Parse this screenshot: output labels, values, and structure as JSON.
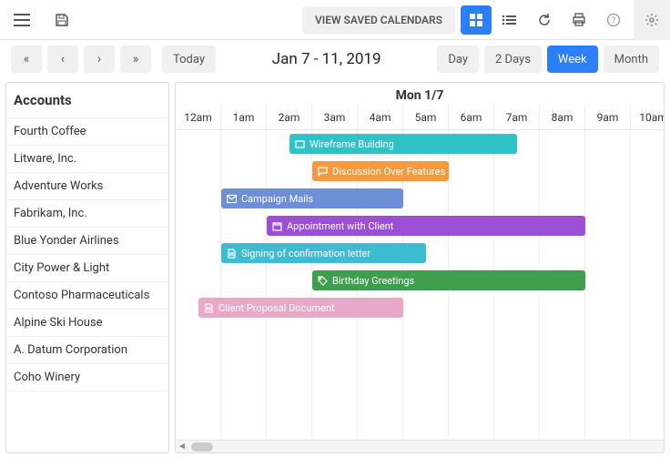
{
  "toolbar": {
    "viewSaved": "VIEW SAVED CALENDARS"
  },
  "nav": {
    "today": "Today",
    "rangeTitle": "Jan 7 - 11, 2019",
    "ranges": [
      "Day",
      "2 Days",
      "Week",
      "Month"
    ],
    "activeRange": 2
  },
  "sidebar": {
    "title": "Accounts",
    "items": [
      "Fourth Coffee",
      "Litware, Inc.",
      "Adventure Works",
      "Fabrikam, Inc.",
      "Blue Yonder Airlines",
      "City Power & Light",
      "Contoso Pharmaceuticals",
      "Alpine Ski House",
      "A. Datum Corporation",
      "Coho Winery"
    ]
  },
  "calendar": {
    "dayLabel": "Mon 1/7",
    "hours": [
      "12am",
      "1am",
      "2am",
      "3am",
      "4am",
      "5am",
      "6am",
      "7am",
      "8am",
      "9am",
      "10am"
    ],
    "hourWidth": 50,
    "events": [
      {
        "row": 0,
        "label": "Wireframe Building",
        "start": 2.5,
        "end": 7.5,
        "color": "#2FC2C7",
        "icon": "card"
      },
      {
        "row": 1,
        "label": "Discussion Over Features",
        "start": 3.0,
        "end": 6.0,
        "color": "#F29B3E",
        "icon": "chat"
      },
      {
        "row": 2,
        "label": "Campaign Mails",
        "start": 1.0,
        "end": 5.0,
        "color": "#6C8FD6",
        "icon": "mail"
      },
      {
        "row": 3,
        "label": "Appointment with Client",
        "start": 2.0,
        "end": 9.0,
        "color": "#9B4FD6",
        "icon": "cal"
      },
      {
        "row": 4,
        "label": "Signing of confirmation letter",
        "start": 1.0,
        "end": 5.5,
        "color": "#3DBBD1",
        "icon": "doc"
      },
      {
        "row": 5,
        "label": "Birthday Greetings",
        "start": 3.0,
        "end": 9.0,
        "color": "#3E9E4E",
        "icon": "tag"
      },
      {
        "row": 6,
        "label": "Client Proposal Document",
        "start": 0.5,
        "end": 5.0,
        "color": "#E8A8C8",
        "icon": "doc"
      }
    ]
  }
}
